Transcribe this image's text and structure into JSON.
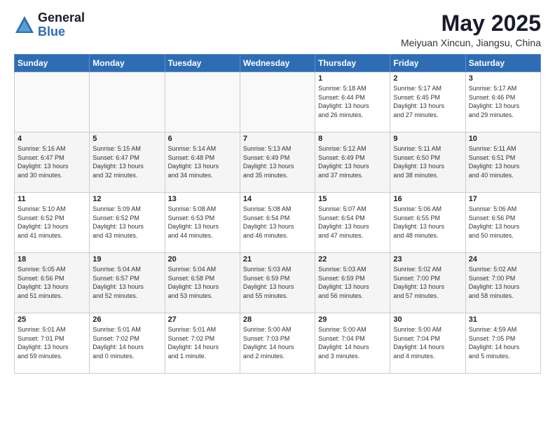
{
  "header": {
    "logo_general": "General",
    "logo_blue": "Blue",
    "title": "May 2025",
    "location": "Meiyuan Xincun, Jiangsu, China"
  },
  "weekdays": [
    "Sunday",
    "Monday",
    "Tuesday",
    "Wednesday",
    "Thursday",
    "Friday",
    "Saturday"
  ],
  "weeks": [
    [
      {
        "day": "",
        "content": ""
      },
      {
        "day": "",
        "content": ""
      },
      {
        "day": "",
        "content": ""
      },
      {
        "day": "",
        "content": ""
      },
      {
        "day": "1",
        "content": "Sunrise: 5:18 AM\nSunset: 6:44 PM\nDaylight: 13 hours\nand 26 minutes."
      },
      {
        "day": "2",
        "content": "Sunrise: 5:17 AM\nSunset: 6:45 PM\nDaylight: 13 hours\nand 27 minutes."
      },
      {
        "day": "3",
        "content": "Sunrise: 5:17 AM\nSunset: 6:46 PM\nDaylight: 13 hours\nand 29 minutes."
      }
    ],
    [
      {
        "day": "4",
        "content": "Sunrise: 5:16 AM\nSunset: 6:47 PM\nDaylight: 13 hours\nand 30 minutes."
      },
      {
        "day": "5",
        "content": "Sunrise: 5:15 AM\nSunset: 6:47 PM\nDaylight: 13 hours\nand 32 minutes."
      },
      {
        "day": "6",
        "content": "Sunrise: 5:14 AM\nSunset: 6:48 PM\nDaylight: 13 hours\nand 34 minutes."
      },
      {
        "day": "7",
        "content": "Sunrise: 5:13 AM\nSunset: 6:49 PM\nDaylight: 13 hours\nand 35 minutes."
      },
      {
        "day": "8",
        "content": "Sunrise: 5:12 AM\nSunset: 6:49 PM\nDaylight: 13 hours\nand 37 minutes."
      },
      {
        "day": "9",
        "content": "Sunrise: 5:11 AM\nSunset: 6:50 PM\nDaylight: 13 hours\nand 38 minutes."
      },
      {
        "day": "10",
        "content": "Sunrise: 5:11 AM\nSunset: 6:51 PM\nDaylight: 13 hours\nand 40 minutes."
      }
    ],
    [
      {
        "day": "11",
        "content": "Sunrise: 5:10 AM\nSunset: 6:52 PM\nDaylight: 13 hours\nand 41 minutes."
      },
      {
        "day": "12",
        "content": "Sunrise: 5:09 AM\nSunset: 6:52 PM\nDaylight: 13 hours\nand 43 minutes."
      },
      {
        "day": "13",
        "content": "Sunrise: 5:08 AM\nSunset: 6:53 PM\nDaylight: 13 hours\nand 44 minutes."
      },
      {
        "day": "14",
        "content": "Sunrise: 5:08 AM\nSunset: 6:54 PM\nDaylight: 13 hours\nand 46 minutes."
      },
      {
        "day": "15",
        "content": "Sunrise: 5:07 AM\nSunset: 6:54 PM\nDaylight: 13 hours\nand 47 minutes."
      },
      {
        "day": "16",
        "content": "Sunrise: 5:06 AM\nSunset: 6:55 PM\nDaylight: 13 hours\nand 48 minutes."
      },
      {
        "day": "17",
        "content": "Sunrise: 5:06 AM\nSunset: 6:56 PM\nDaylight: 13 hours\nand 50 minutes."
      }
    ],
    [
      {
        "day": "18",
        "content": "Sunrise: 5:05 AM\nSunset: 6:56 PM\nDaylight: 13 hours\nand 51 minutes."
      },
      {
        "day": "19",
        "content": "Sunrise: 5:04 AM\nSunset: 6:57 PM\nDaylight: 13 hours\nand 52 minutes."
      },
      {
        "day": "20",
        "content": "Sunrise: 5:04 AM\nSunset: 6:58 PM\nDaylight: 13 hours\nand 53 minutes."
      },
      {
        "day": "21",
        "content": "Sunrise: 5:03 AM\nSunset: 6:59 PM\nDaylight: 13 hours\nand 55 minutes."
      },
      {
        "day": "22",
        "content": "Sunrise: 5:03 AM\nSunset: 6:59 PM\nDaylight: 13 hours\nand 56 minutes."
      },
      {
        "day": "23",
        "content": "Sunrise: 5:02 AM\nSunset: 7:00 PM\nDaylight: 13 hours\nand 57 minutes."
      },
      {
        "day": "24",
        "content": "Sunrise: 5:02 AM\nSunset: 7:00 PM\nDaylight: 13 hours\nand 58 minutes."
      }
    ],
    [
      {
        "day": "25",
        "content": "Sunrise: 5:01 AM\nSunset: 7:01 PM\nDaylight: 13 hours\nand 59 minutes."
      },
      {
        "day": "26",
        "content": "Sunrise: 5:01 AM\nSunset: 7:02 PM\nDaylight: 14 hours\nand 0 minutes."
      },
      {
        "day": "27",
        "content": "Sunrise: 5:01 AM\nSunset: 7:02 PM\nDaylight: 14 hours\nand 1 minute."
      },
      {
        "day": "28",
        "content": "Sunrise: 5:00 AM\nSunset: 7:03 PM\nDaylight: 14 hours\nand 2 minutes."
      },
      {
        "day": "29",
        "content": "Sunrise: 5:00 AM\nSunset: 7:04 PM\nDaylight: 14 hours\nand 3 minutes."
      },
      {
        "day": "30",
        "content": "Sunrise: 5:00 AM\nSunset: 7:04 PM\nDaylight: 14 hours\nand 4 minutes."
      },
      {
        "day": "31",
        "content": "Sunrise: 4:59 AM\nSunset: 7:05 PM\nDaylight: 14 hours\nand 5 minutes."
      }
    ]
  ]
}
